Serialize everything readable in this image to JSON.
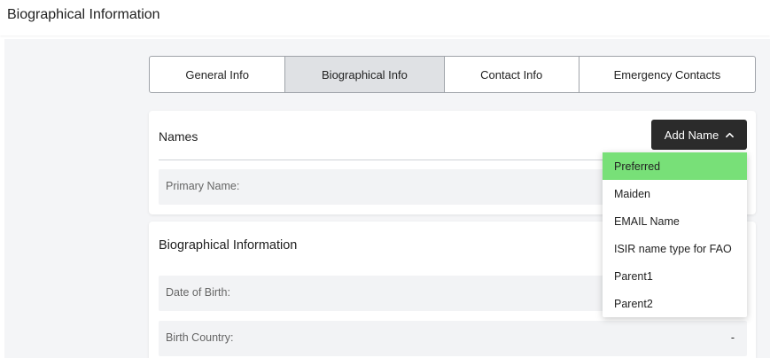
{
  "header": {
    "title": "Biographical Information"
  },
  "tabs": [
    {
      "label": "General Info"
    },
    {
      "label": "Biographical Info",
      "active": true
    },
    {
      "label": "Contact Info"
    },
    {
      "label": "Emergency Contacts"
    }
  ],
  "names_card": {
    "title": "Names",
    "add_button_label": "Add Name",
    "fields": [
      {
        "label": "Primary Name:"
      }
    ]
  },
  "dropdown": {
    "items": [
      {
        "label": "Preferred",
        "highlighted": true
      },
      {
        "label": "Maiden"
      },
      {
        "label": "EMAIL Name"
      },
      {
        "label": "ISIR name type for FAO"
      },
      {
        "label": "Parent1"
      },
      {
        "label": "Parent2"
      }
    ]
  },
  "bio_card": {
    "title": "Biographical Information",
    "fields": [
      {
        "label": "Date of Birth:"
      },
      {
        "label": "Birth Country:",
        "value": "-"
      }
    ]
  },
  "colors": {
    "highlight": "#78e078",
    "button_bg": "#2b2b2b",
    "active_tab_bg": "#dfe1e4"
  }
}
